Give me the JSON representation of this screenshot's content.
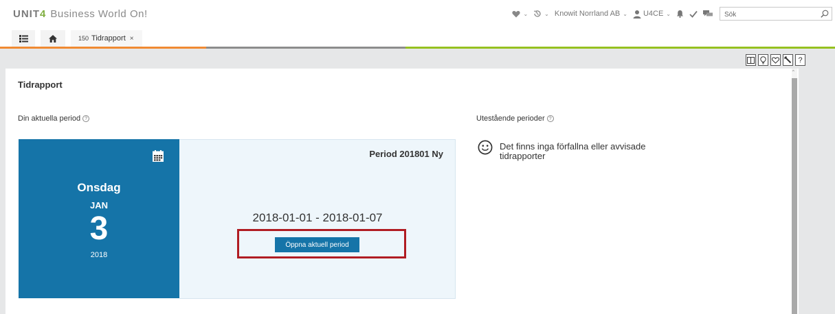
{
  "header": {
    "brand": "UNIT",
    "brand_mark": "4",
    "product": "Business World On!",
    "company": "Knowit Norrland AB",
    "user": "U4CE",
    "search": {
      "value": "",
      "placeholder": "Sök"
    }
  },
  "tabs": [
    {
      "icon": "list-icon"
    },
    {
      "icon": "home-icon"
    },
    {
      "number": "150",
      "label": "Tidrapport",
      "close": "×"
    }
  ],
  "tab_stripe_colors": [
    "#f08a32",
    "#8c8c8c",
    "#95c11f"
  ],
  "toolbar_icons": [
    "layout-icon",
    "lightbulb-icon",
    "favorite-icon",
    "wrench-icon",
    "help-icon"
  ],
  "toolbar_help_glyph": "?",
  "page": {
    "title": "Tidrapport",
    "current_period_label": "Din aktuella period",
    "outstanding_label": "Utestående perioder",
    "help_glyph": "?"
  },
  "date": {
    "day_name": "Onsdag",
    "month": "JAN",
    "day": "3",
    "year": "2018"
  },
  "period": {
    "title": "Period 201801  Ny",
    "range": "2018-01-01 - 2018-01-07",
    "open_button": "Öppna aktuell period"
  },
  "outstanding": {
    "message": "Det finns inga förfallna eller avvisade tidrapporter"
  },
  "colors": {
    "accent_blue": "#1574a8",
    "highlight_red": "#b01c22",
    "brand_green": "#7fae3f"
  }
}
